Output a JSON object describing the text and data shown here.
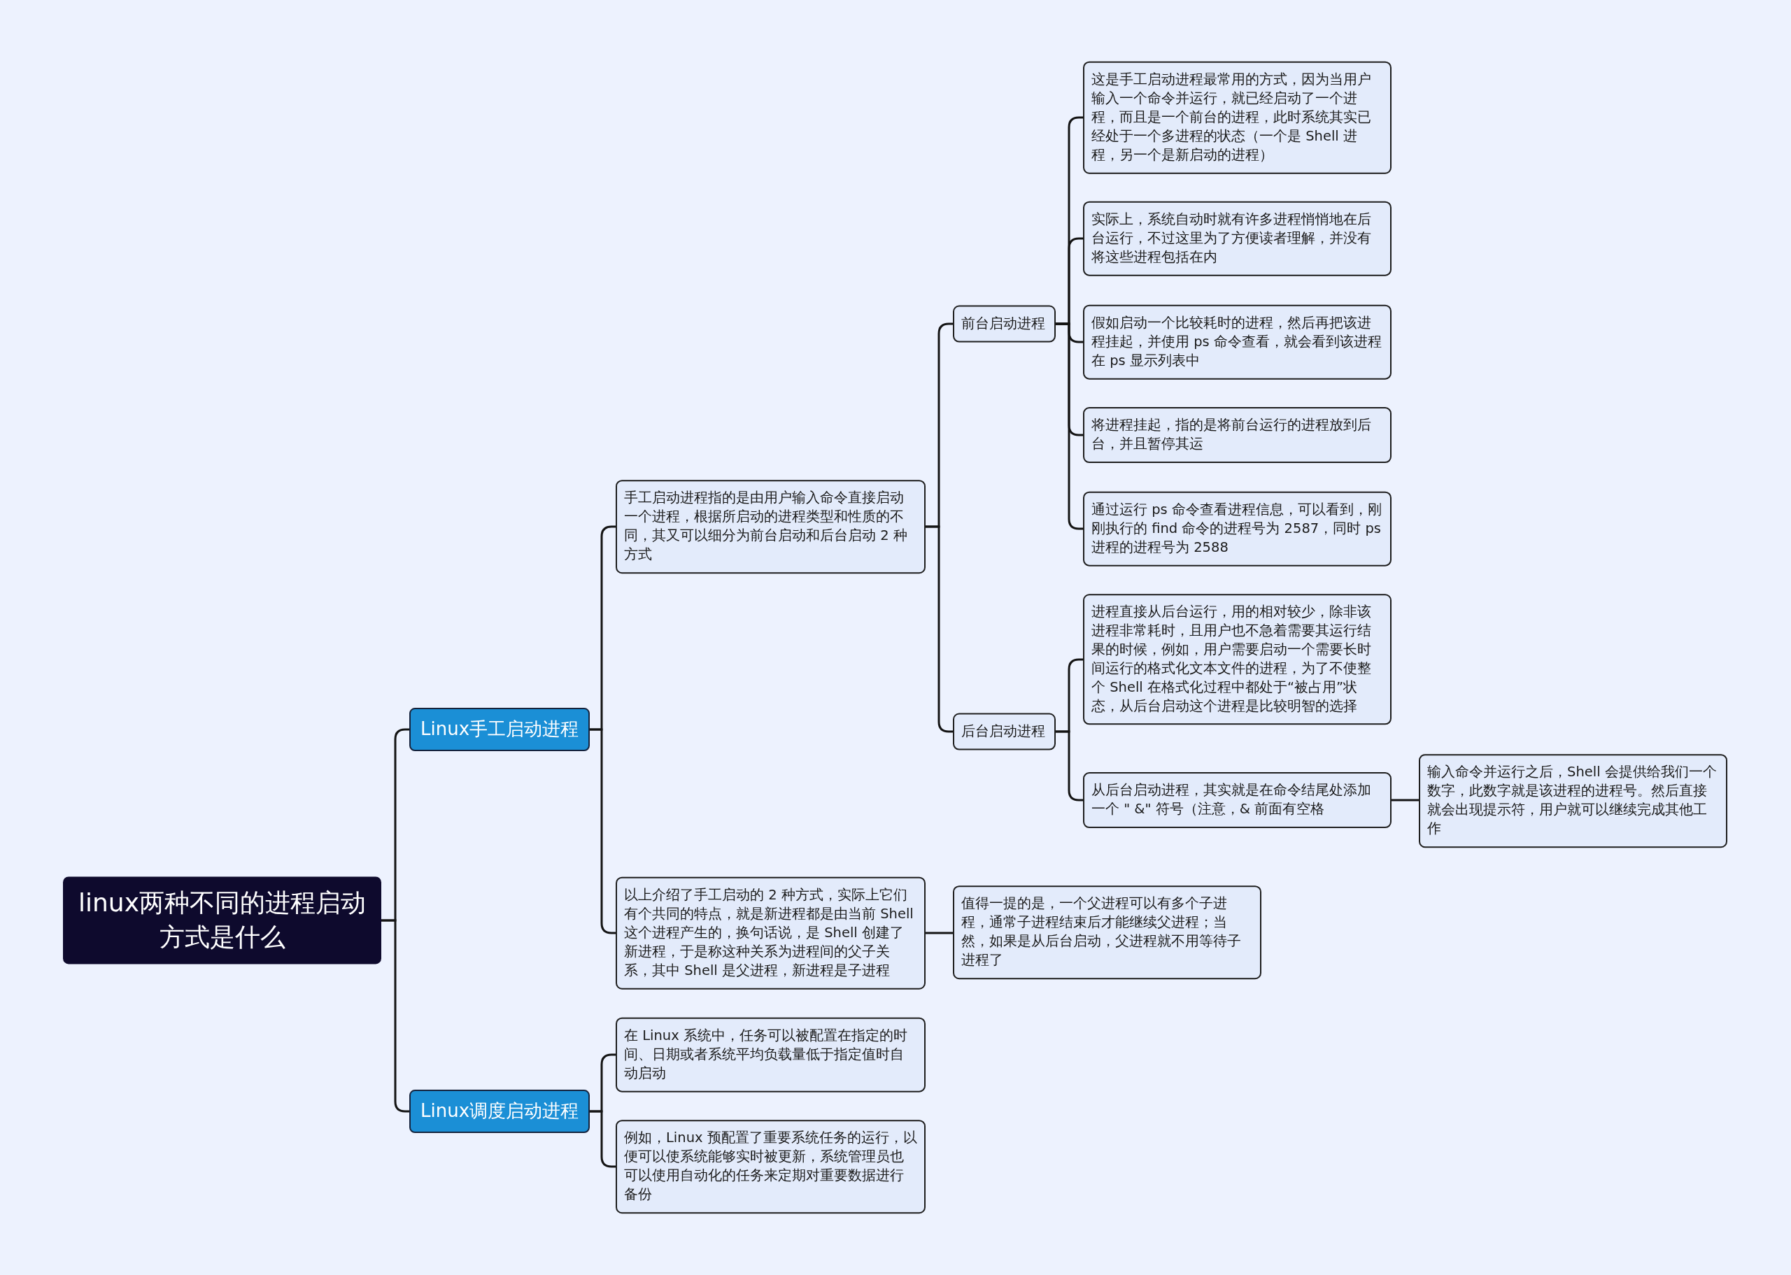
{
  "mind_map": {
    "root": {
      "text": "linux两种不同的进程启动方式是什么",
      "children": [
        {
          "text": "Linux手工启动进程",
          "children": [
            {
              "text": "手工启动进程指的是由用户输入命令直接启动一个进程，根据所启动的进程类型和性质的不同，其又可以细分为前台启动和后台启动 2 种方式",
              "children": [
                {
                  "text": "前台启动进程",
                  "children": [
                    {
                      "text": "这是手工启动进程最常用的方式，因为当用户输入一个命令并运行，就已经启动了一个进程，而且是一个前台的进程，此时系统其实已经处于一个多进程的状态（一个是 Shell 进程，另一个是新启动的进程）"
                    },
                    {
                      "text": "实际上，系统自动时就有许多进程悄悄地在后台运行，不过这里为了方便读者理解，并没有将这些进程包括在内"
                    },
                    {
                      "text": "假如启动一个比较耗时的进程，然后再把该进程挂起，并使用 ps 命令查看，就会看到该进程在 ps 显示列表中"
                    },
                    {
                      "text": "将进程挂起，指的是将前台运行的进程放到后台，并且暂停其运"
                    },
                    {
                      "text": "通过运行 ps 命令查看进程信息，可以看到，刚刚执行的 find 命令的进程号为 2587，同时 ps 进程的进程号为 2588"
                    }
                  ]
                },
                {
                  "text": "后台启动进程",
                  "children": [
                    {
                      "text": "进程直接从后台运行，用的相对较少，除非该进程非常耗时，且用户也不急着需要其运行结果的时候，例如，用户需要启动一个需要长时间运行的格式化文本文件的进程，为了不使整个 Shell 在格式化过程中都处于“被占用”状态，从后台启动这个进程是比较明智的选择"
                    },
                    {
                      "text": "从后台启动进程，其实就是在命令结尾处添加一个 \" &\" 符号（注意，& 前面有空格",
                      "children": [
                        {
                          "text": "输入命令并运行之后，Shell 会提供给我们一个数字，此数字就是该进程的进程号。然后直接就会出现提示符，用户就可以继续完成其他工作"
                        }
                      ]
                    }
                  ]
                }
              ]
            },
            {
              "text": "以上介绍了手工启动的 2 种方式，实际上它们有个共同的特点，就是新进程都是由当前 Shell 这个进程产生的，换句话说，是 Shell 创建了新进程，于是称这种关系为进程间的父子关系，其中 Shell 是父进程，新进程是子进程",
              "children": [
                {
                  "text": "值得一提的是，一个父进程可以有多个子进程，通常子进程结束后才能继续父进程；当然，如果是从后台启动，父进程就不用等待子进程了"
                }
              ]
            }
          ]
        },
        {
          "text": "Linux调度启动进程",
          "children": [
            {
              "text": "在 Linux 系统中，任务可以被配置在指定的时间、日期或者系统平均负载量低于指定值时自动启动"
            },
            {
              "text": "例如，Linux 预配置了重要系统任务的运行，以便可以使系统能够实时被更新，系统管理员也可以使用自动化的任务来定期对重要数据进行备份"
            }
          ]
        }
      ]
    }
  }
}
